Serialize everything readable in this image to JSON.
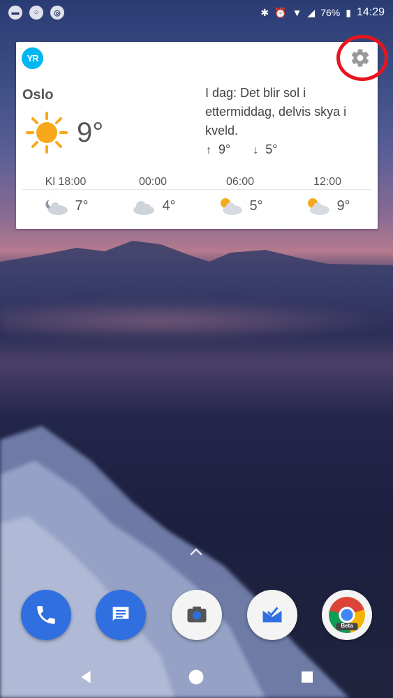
{
  "status_bar": {
    "battery": "76%",
    "time": "14:29",
    "left_icons": [
      "chat-bubble-icon",
      "search-icon",
      "circle-menu-icon"
    ],
    "right_icons": [
      "bluetooth-icon",
      "alarm-icon",
      "wifi-icon",
      "signal-icon",
      "battery-icon"
    ]
  },
  "widget": {
    "logo": "YR",
    "city": "Oslo",
    "current_temp": "9°",
    "forecast_text": "I dag: Det blir sol i ettermiddag, delvis skya i kveld.",
    "high": "9°",
    "low": "5°",
    "hours": [
      {
        "label": "Kl 18:00",
        "temp": "7°",
        "icon": "cloud-moon-icon"
      },
      {
        "label": "00:00",
        "temp": "4°",
        "icon": "cloud-icon"
      },
      {
        "label": "06:00",
        "temp": "5°",
        "icon": "cloud-sun-icon"
      },
      {
        "label": "12:00",
        "temp": "9°",
        "icon": "cloud-sun-icon"
      }
    ],
    "colors": {
      "logo": "#00b6f1",
      "sun": "#f7a81b",
      "highlight": "#e8141d"
    }
  },
  "dock": {
    "apps": [
      "phone-icon",
      "messages-icon",
      "camera-icon",
      "inbox-icon",
      "chrome-beta-icon"
    ],
    "chrome_label": "Beta"
  },
  "nav": [
    "back-icon",
    "home-icon",
    "recents-icon"
  ]
}
